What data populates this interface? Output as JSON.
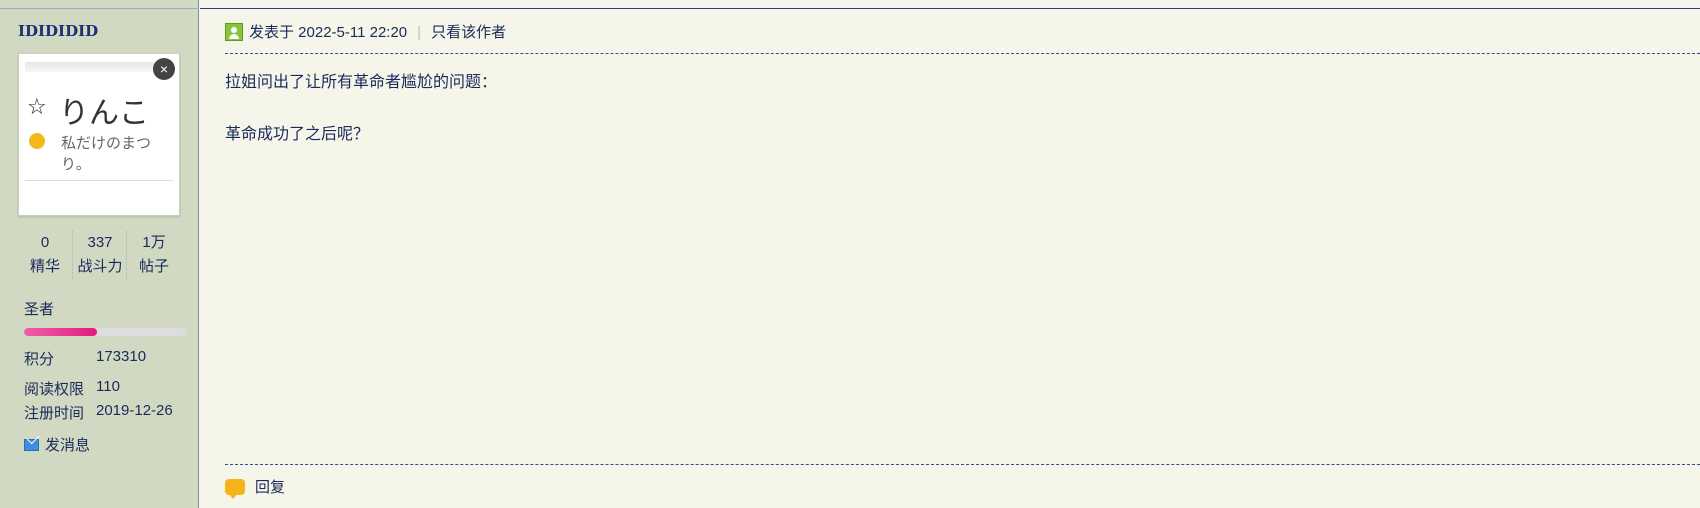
{
  "user": {
    "name": "IDIDIDID",
    "avatar": {
      "title": "りんこ",
      "subtitle": "私だけのまつり。",
      "close_glyph": "×",
      "star_glyph": "☆"
    },
    "stats": [
      {
        "value": "0",
        "label": "精华"
      },
      {
        "value": "337",
        "label": "战斗力"
      },
      {
        "value": "1万",
        "label": "帖子"
      }
    ],
    "rank": "圣者",
    "rank_progress": 0.45,
    "info": [
      {
        "label": "积分",
        "value": "173310"
      },
      {
        "label": "阅读权限",
        "value": "110"
      },
      {
        "label": "注册时间",
        "value": "2019-12-26"
      }
    ],
    "send_message_label": "发消息"
  },
  "post": {
    "posted_label": "发表于 2022-5-11 22:20",
    "separator": "|",
    "only_author_label": "只看该作者",
    "content_lines": [
      "拉姐问出了让所有革命者尴尬的问题：",
      "革命成功了之后呢？"
    ],
    "reply_label": "回复"
  },
  "colors": {
    "sidebar_bg": "#d1d9c2",
    "main_bg": "#f5f5ea",
    "text": "#1a2a5a",
    "progress_fill": "#e01d7a",
    "reply_icon": "#f5b417",
    "author_icon": "#8ac43b"
  },
  "icons": [
    "author-icon",
    "mail-icon",
    "reply-bubble-icon",
    "close-icon",
    "star-icon",
    "clock-icon"
  ]
}
